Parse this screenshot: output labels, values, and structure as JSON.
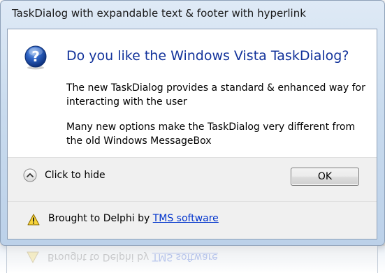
{
  "window": {
    "title": "TaskDialog with expandable text & footer with hyperlink"
  },
  "main": {
    "icon": "question-icon",
    "instruction": "Do you like the Windows Vista TaskDialog?",
    "content_1": "The new TaskDialog provides a standard & enhanced way for interacting with the user",
    "content_2": "Many new options make the TaskDialog very different from the old Windows MessageBox"
  },
  "buttons": {
    "expando_icon": "chevron-up-circle-icon",
    "expando_label": "Click to hide",
    "ok_label": "OK"
  },
  "footer": {
    "icon": "warning-icon",
    "text": "Brought to Delphi by ",
    "link": "TMS software"
  },
  "colors": {
    "instruction": "#13339b",
    "link": "#0033cc",
    "button_area": "#f0f0f0",
    "frame": "#c9dbee"
  }
}
